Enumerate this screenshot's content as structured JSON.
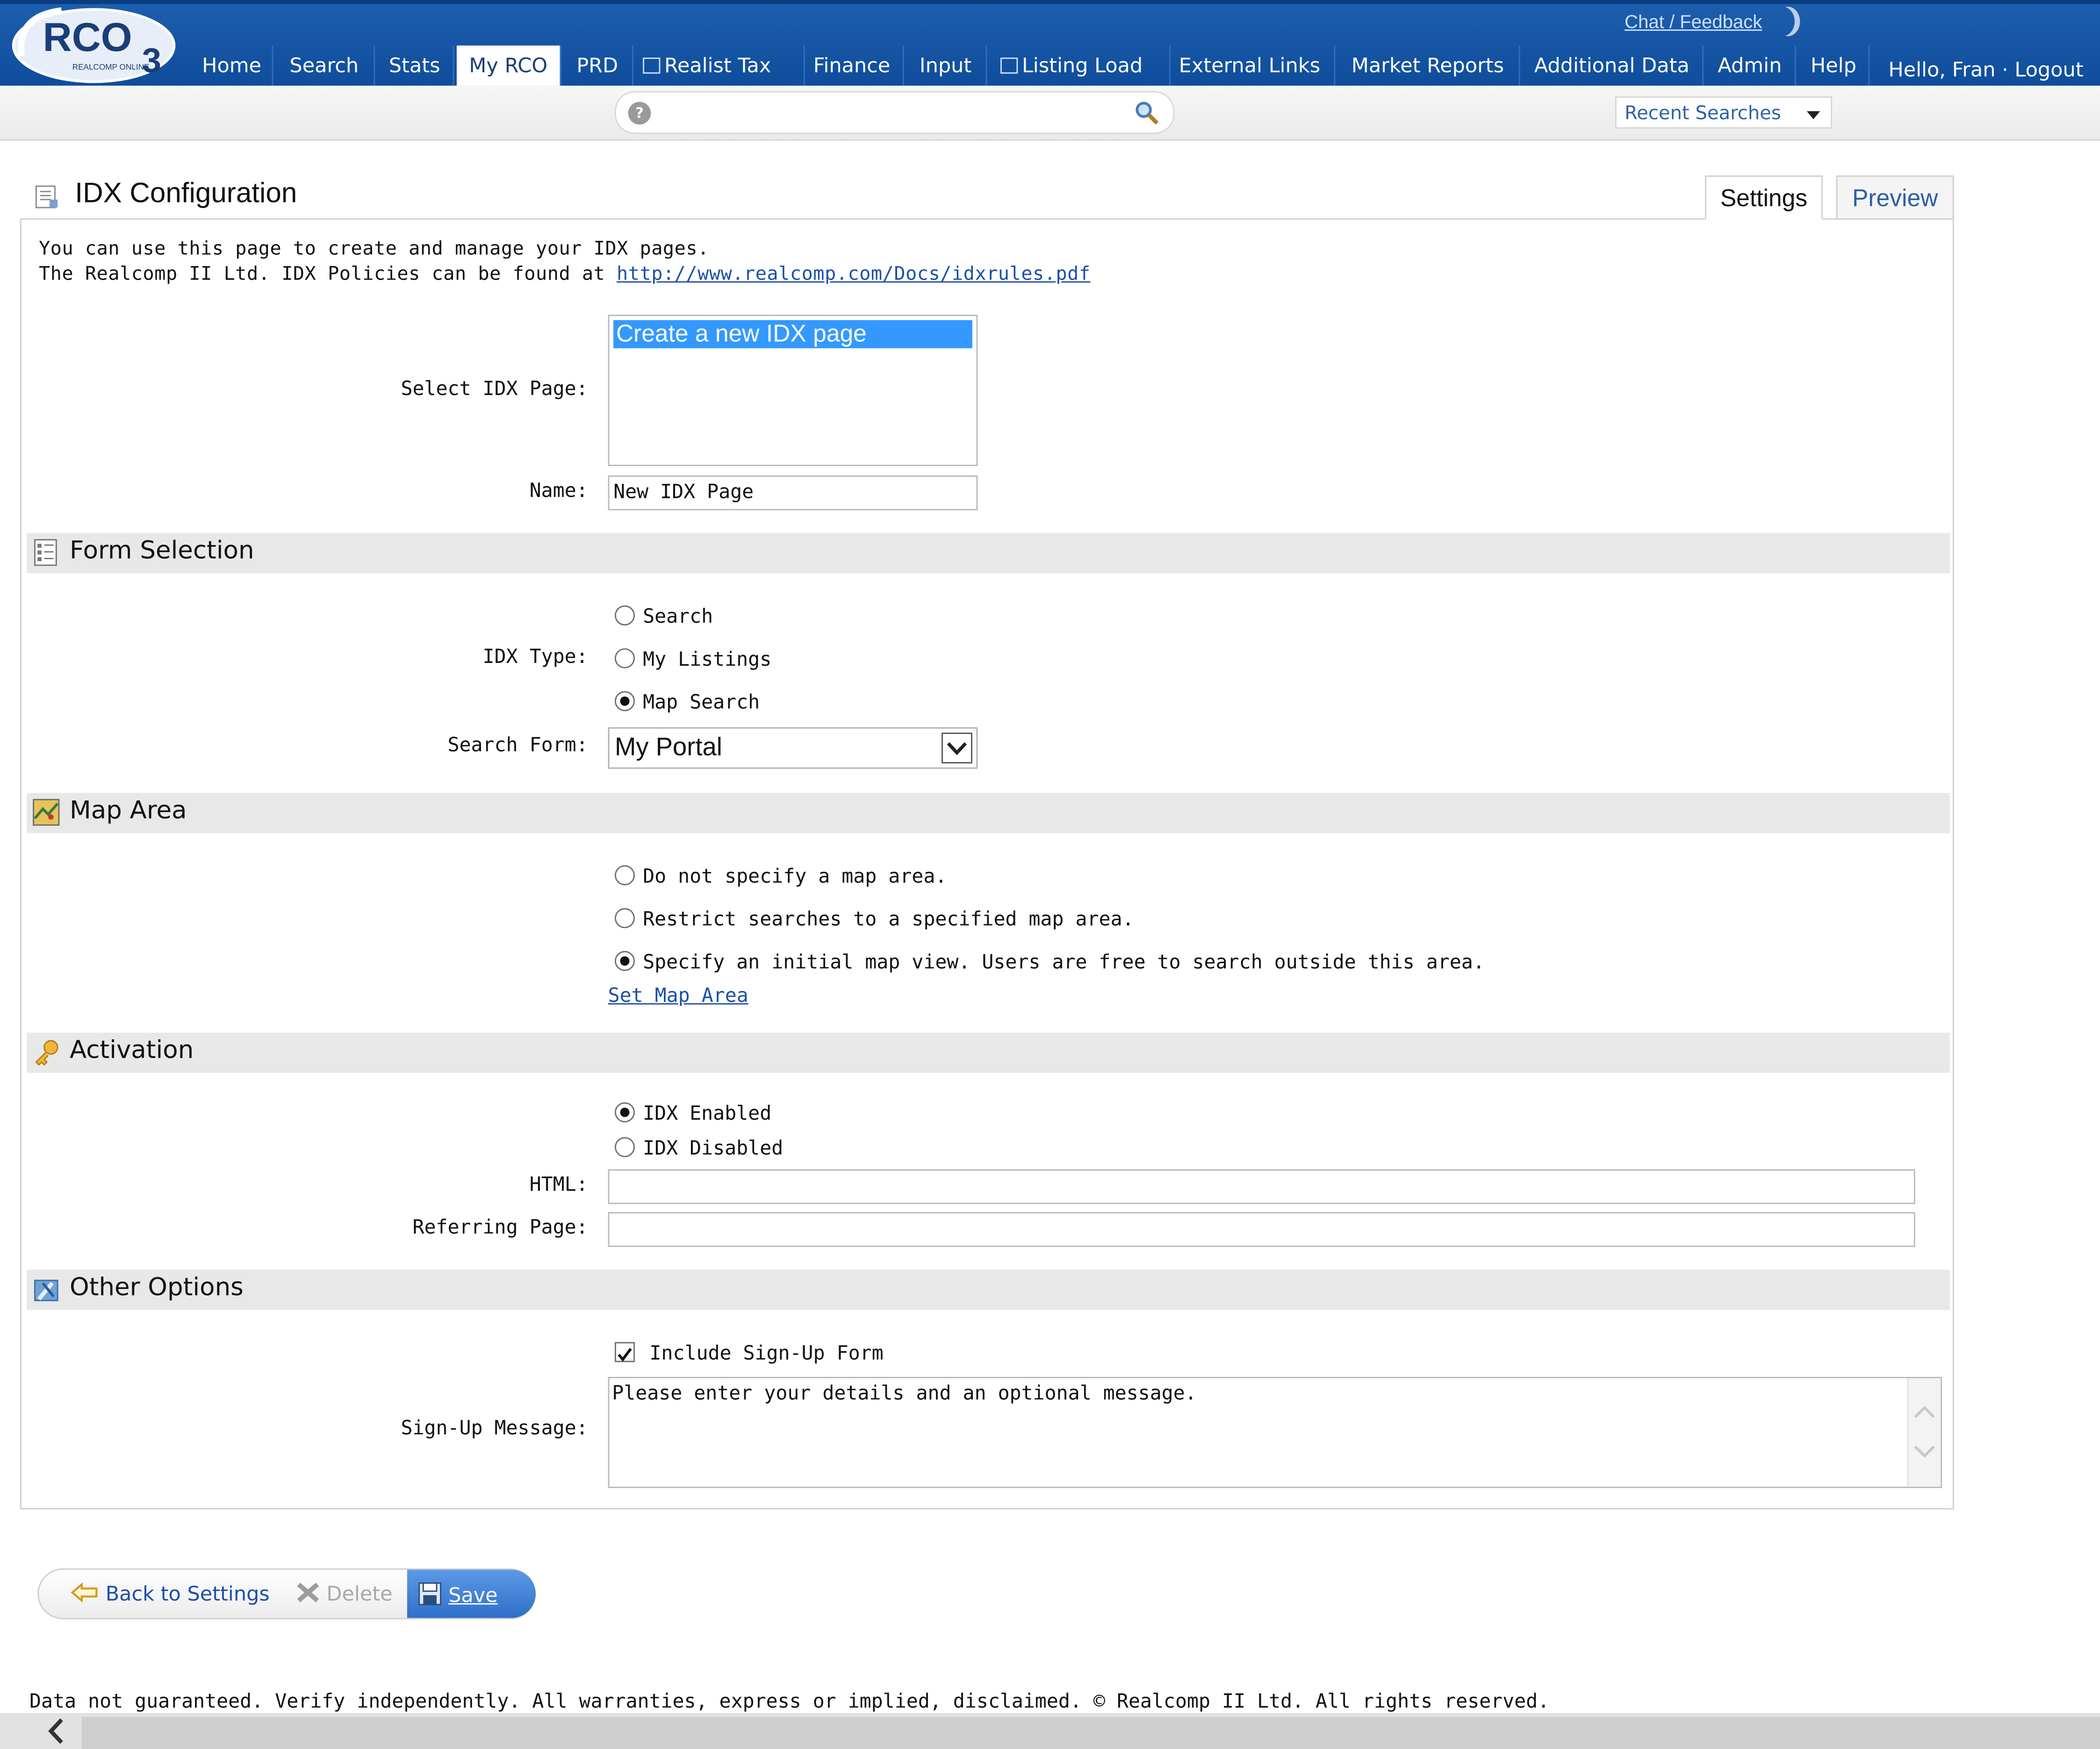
{
  "header": {
    "logo_text": "RCO",
    "logo_sub": "REALCOMP ONLINE",
    "nav": [
      {
        "label": "Home"
      },
      {
        "label": "Search"
      },
      {
        "label": "Stats"
      },
      {
        "label": "My RCO",
        "active": true
      },
      {
        "label": "PRD"
      },
      {
        "label": "Realist Tax"
      },
      {
        "label": "Finance"
      },
      {
        "label": "Input"
      },
      {
        "label": "Listing Load"
      },
      {
        "label": "External Links"
      },
      {
        "label": "Market Reports"
      },
      {
        "label": "Additional Data"
      },
      {
        "label": "Admin"
      },
      {
        "label": "Help"
      }
    ],
    "chat_label": "Chat / Feedback",
    "greeting": "Hello, Fran · Logout",
    "recent_searches_label": "Recent Searches"
  },
  "page": {
    "title": "IDX Configuration",
    "tabs": {
      "settings": "Settings",
      "preview": "Preview"
    },
    "intro_line1": "You can use this page to create and manage your IDX pages.",
    "intro_line2_prefix": "The Realcomp II Ltd. IDX Policies can be found at ",
    "intro_link": "http://www.realcomp.com/Docs/idxrules.pdf"
  },
  "form": {
    "select_page_label": "Select IDX Page:",
    "select_page_selected": "Create a new IDX page",
    "name_label": "Name:",
    "name_value": "New IDX Page",
    "form_selection": {
      "title": "Form Selection",
      "idx_type_label": "IDX Type:",
      "idx_type_options": [
        "Search",
        "My Listings",
        "Map Search"
      ],
      "idx_type_selected": "Map Search",
      "search_form_label": "Search Form:",
      "search_form_value": "My Portal"
    },
    "map_area": {
      "title": "Map Area",
      "options": [
        "Do not specify a map area.",
        "Restrict searches to a specified map area.",
        "Specify an initial map view. Users are free to search outside this area."
      ],
      "selected_index": 2,
      "set_map_link": "Set Map Area"
    },
    "activation": {
      "title": "Activation",
      "options": [
        "IDX Enabled",
        "IDX Disabled"
      ],
      "selected": "IDX Enabled",
      "html_label": "HTML:",
      "html_value": "",
      "referring_label": "Referring Page:",
      "referring_value": ""
    },
    "other_options": {
      "title": "Other Options",
      "include_signup_label": "Include Sign-Up Form",
      "include_signup_checked": true,
      "signup_message_label": "Sign-Up Message:",
      "signup_message_value": "Please enter your details and an optional message."
    }
  },
  "toolbar": {
    "back_label": "Back to Settings",
    "delete_label": "Delete",
    "save_label": "Save"
  },
  "footer": {
    "disclaimer": "Data not guaranteed. Verify independently. All warranties, express or implied, disclaimed. © Realcomp II Ltd. All rights reserved."
  }
}
